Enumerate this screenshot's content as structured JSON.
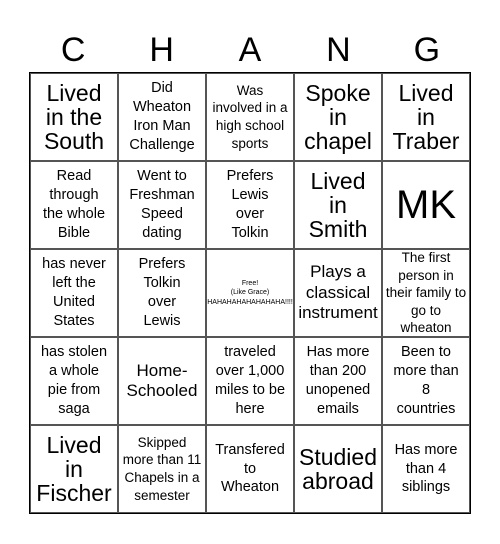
{
  "card": {
    "header_letters": [
      "C",
      "H",
      "A",
      "N",
      "G"
    ],
    "free_space": {
      "lines": "Free!\n(Like Grace)\nHAHAHAHAHAHAHAHA!!!!"
    },
    "rows": [
      [
        {
          "text": "Lived\nin the\nSouth",
          "size": "lg"
        },
        {
          "text": "Did\nWheaton\nIron Man\nChallenge",
          "size": "sm"
        },
        {
          "text": "Was\ninvolved in a\nhigh school\nsports",
          "size": "xs"
        },
        {
          "text": "Spoke\nin\nchapel",
          "size": "lg"
        },
        {
          "text": "Lived\nin\nTraber",
          "size": "lg"
        }
      ],
      [
        {
          "text": "Read\nthrough\nthe whole\nBible",
          "size": "sm"
        },
        {
          "text": "Went to\nFreshman\nSpeed\ndating",
          "size": "sm"
        },
        {
          "text": "Prefers\nLewis\nover\nTolkin",
          "size": "sm"
        },
        {
          "text": "Lived\nin\nSmith",
          "size": "lg"
        },
        {
          "text": "MK",
          "size": "xl"
        }
      ],
      [
        {
          "text": "has never\nleft the\nUnited\nStates",
          "size": "sm"
        },
        {
          "text": "Prefers\nTolkin\nover\nLewis",
          "size": "sm"
        },
        {
          "text": "FREE",
          "size": "tiny",
          "free": true
        },
        {
          "text": "Plays a\nclassical\ninstrument",
          "size": "md"
        },
        {
          "text": "The first\nperson in\ntheir family to\ngo to\nwheaton",
          "size": "xs"
        }
      ],
      [
        {
          "text": "has stolen\na whole\npie from\nsaga",
          "size": "sm"
        },
        {
          "text": "Home-\nSchooled",
          "size": "md"
        },
        {
          "text": "traveled\nover 1,000\nmiles to be\nhere",
          "size": "sm"
        },
        {
          "text": "Has more\nthan 200\nunopened\nemails",
          "size": "sm"
        },
        {
          "text": "Been to\nmore than\n8\ncountries",
          "size": "sm"
        }
      ],
      [
        {
          "text": "Lived\nin\nFischer",
          "size": "lg"
        },
        {
          "text": "Skipped\nmore than 11\nChapels in a\nsemester",
          "size": "xs"
        },
        {
          "text": "Transfered\nto\nWheaton",
          "size": "sm"
        },
        {
          "text": "Studied\nabroad",
          "size": "lg"
        },
        {
          "text": "Has more\nthan 4\nsiblings",
          "size": "sm"
        }
      ]
    ]
  }
}
